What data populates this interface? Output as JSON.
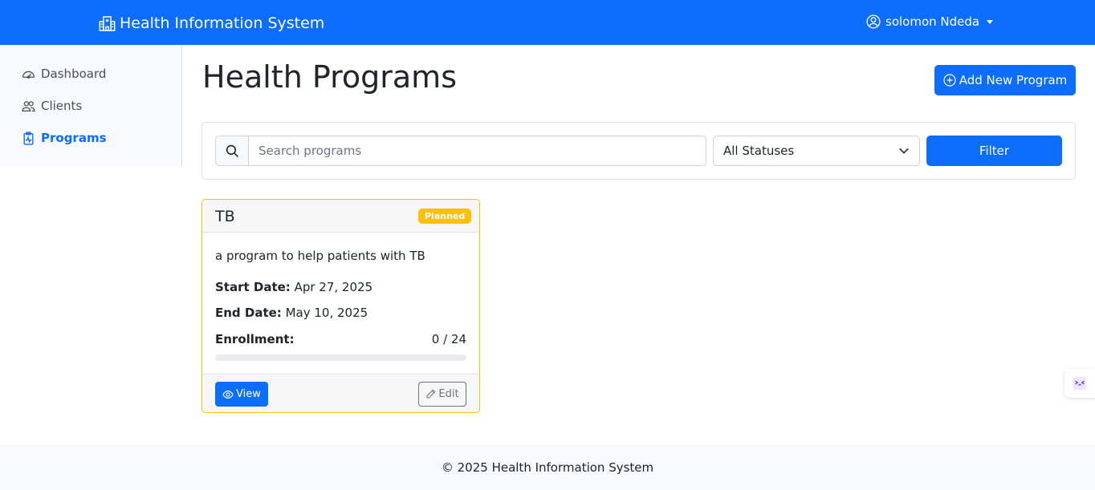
{
  "navbar": {
    "brand": "Health Information System",
    "brand_icon": "hospital-icon",
    "user_name": "solomon Ndeda",
    "user_icon": "person-circle-icon",
    "bg_color": "#0d6efd"
  },
  "sidebar": {
    "items": [
      {
        "label": "Dashboard",
        "icon": "speedometer-icon",
        "active": false
      },
      {
        "label": "Clients",
        "icon": "people-icon",
        "active": false
      },
      {
        "label": "Programs",
        "icon": "clipboard-pulse-icon",
        "active": true
      }
    ]
  },
  "main": {
    "title": "Health Programs",
    "add_button": "Add New Program"
  },
  "filters": {
    "search_placeholder": "Search programs",
    "search_value": "",
    "status_selected": "All Statuses",
    "filter_button": "Filter"
  },
  "programs": [
    {
      "name": "TB",
      "status": "Planned",
      "status_color": "#ffc107",
      "description": "a program to help patients with TB",
      "start_label": "Start Date:",
      "start_date": "Apr 27, 2025",
      "end_label": "End Date:",
      "end_date": "May 10, 2025",
      "enrollment_label": "Enrollment:",
      "enrollment_text": "0 / 24",
      "enrolled": 0,
      "capacity": 24,
      "view_button": "View",
      "edit_button": "Edit"
    }
  ],
  "footer": {
    "text": "© 2025 Health Information System"
  }
}
